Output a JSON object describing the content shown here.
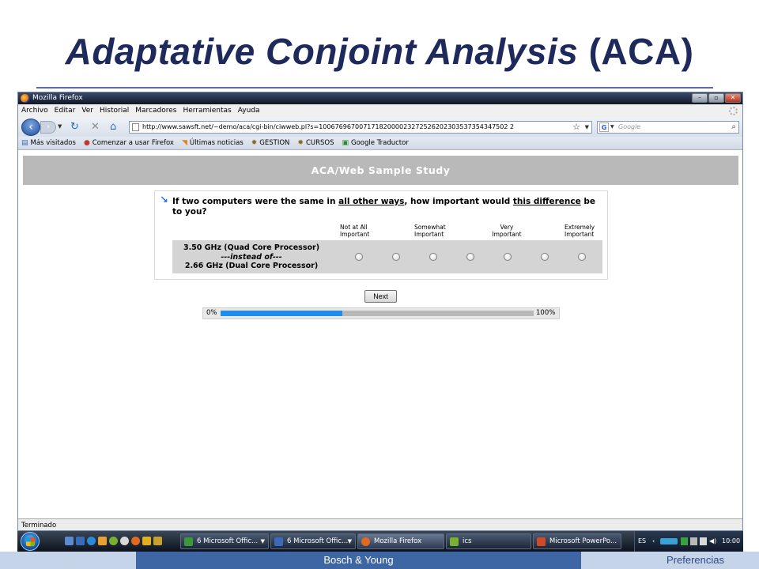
{
  "slide": {
    "title_italic": "Adaptative Conjoint Analysis",
    "title_plain": " (ACA)"
  },
  "browser": {
    "window_title": "Mozilla Firefox",
    "window_buttons": {
      "minimize": "–",
      "maximize": "▫",
      "close": "✕"
    },
    "menu": [
      "Archivo",
      "Editar",
      "Ver",
      "Historial",
      "Marcadores",
      "Herramientas",
      "Ayuda"
    ],
    "url": "http://www.sawsft.net/~demo/aca/cgi-bin/ciwweb.pl?s=10067696700717182000023272526202303537354347502 2",
    "search_placeholder": "Google",
    "search_engine_letter": "G",
    "bookmarks": [
      "Más visitados",
      "Comenzar a usar Firefox",
      "Últimas noticias",
      "GESTION",
      "CURSOS",
      "Google Traductor"
    ],
    "status": "Terminado"
  },
  "survey": {
    "header": "ACA/Web Sample Study",
    "question_parts": {
      "p1": "If two computers were the same in ",
      "u1": "all other ways",
      "p2": ", how important would ",
      "u2": "this difference",
      "p3": " be to you?"
    },
    "scale_labels": [
      [
        "Not at All",
        "Important"
      ],
      [
        "Somewhat",
        "Important"
      ],
      [
        "Very",
        "Important"
      ],
      [
        "Extremely",
        "Important"
      ]
    ],
    "pair": {
      "option_a": "3.50 GHz (Quad Core Processor)",
      "separator": "---instead of---",
      "option_b": "2.66 GHz (Dual Core Processor)"
    },
    "radio_count": 7,
    "next_label": "Next",
    "progress": {
      "start_label": "0%",
      "end_label": "100%",
      "value_percent": 39
    }
  },
  "taskbar": {
    "tasks": [
      "6 Microsoft Offic...",
      "6 Microsoft Offic...",
      "Mozilla Firefox",
      "ics",
      "Microsoft PowerPo..."
    ],
    "tray_lang": "ES",
    "clock": "10:00"
  },
  "footer": {
    "center": "Bosch & Young",
    "right": "Preferencias"
  },
  "colors": {
    "title": "#1f2a5c",
    "study_header": "#b9b9b9",
    "progress_fill": "#1e8cf0",
    "footer_mid": "#3e66a4",
    "footer_side": "#c6d4ea"
  }
}
